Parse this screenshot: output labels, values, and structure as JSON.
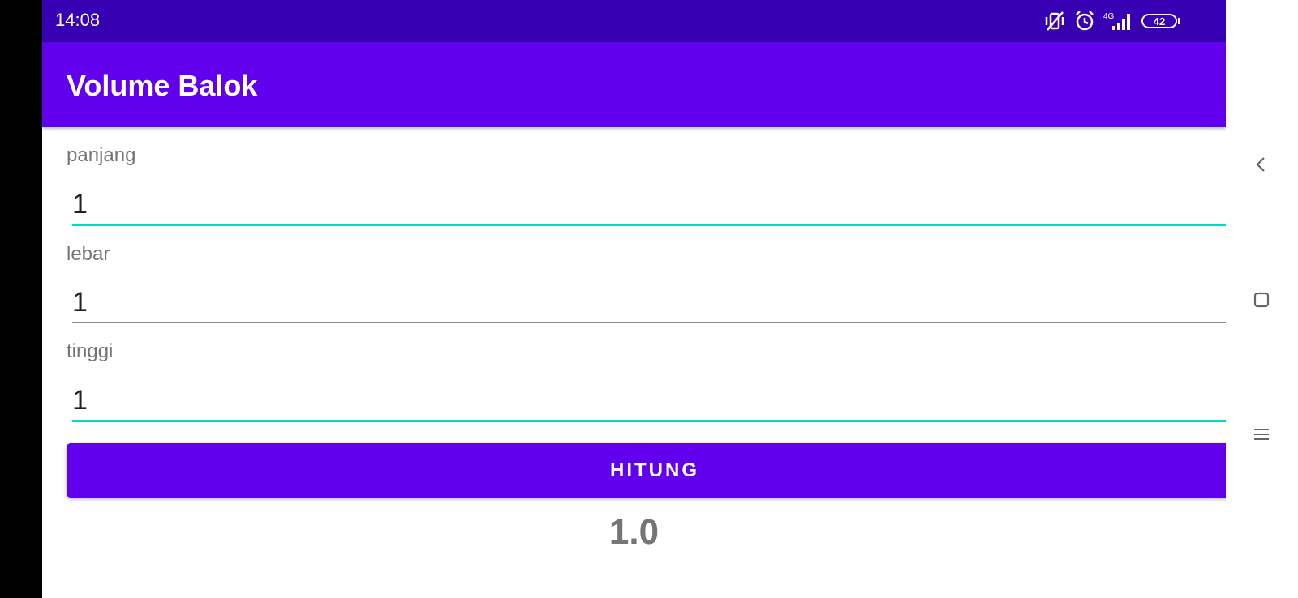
{
  "status_bar": {
    "time": "14:08",
    "network_label": "4G",
    "battery_level": "42",
    "icons": [
      "vibrate-off-icon",
      "alarm-icon",
      "signal-icon",
      "battery-icon"
    ]
  },
  "app": {
    "title": "Volume Balok",
    "accent_color": "#6200ee",
    "status_bar_color": "#3700b3",
    "focus_underline_color": "#03dac5"
  },
  "form": {
    "fields": [
      {
        "label": "panjang",
        "value": "1"
      },
      {
        "label": "lebar",
        "value": "1"
      },
      {
        "label": "tinggi",
        "value": "1"
      }
    ],
    "button_label": "HITUNG",
    "result": "1.0"
  },
  "navigation": {
    "icons": [
      "back-icon",
      "home-icon",
      "recents-icon"
    ]
  }
}
